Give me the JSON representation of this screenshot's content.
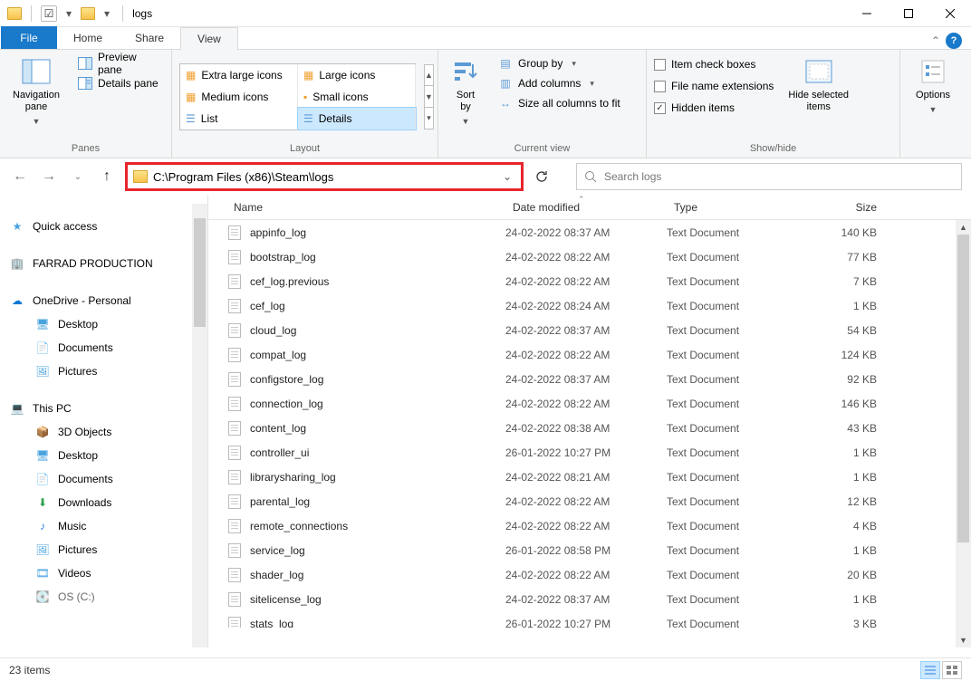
{
  "title": "logs",
  "tabs": {
    "file": "File",
    "home": "Home",
    "share": "Share",
    "view": "View"
  },
  "ribbon": {
    "panes": {
      "nav": "Navigation\npane",
      "preview": "Preview pane",
      "details": "Details pane",
      "label": "Panes"
    },
    "layout": {
      "xl": "Extra large icons",
      "lg": "Large icons",
      "md": "Medium icons",
      "sm": "Small icons",
      "list": "List",
      "det": "Details",
      "label": "Layout"
    },
    "current": {
      "sort": "Sort\nby",
      "group": "Group by",
      "addcols": "Add columns",
      "sizeall": "Size all columns to fit",
      "label": "Current view"
    },
    "showhide": {
      "itemcb": "Item check boxes",
      "ext": "File name extensions",
      "hidden": "Hidden items",
      "hidesel": "Hide selected\nitems",
      "label": "Show/hide"
    },
    "options": "Options"
  },
  "address": "C:\\Program Files (x86)\\Steam\\logs",
  "search_placeholder": "Search logs",
  "columns": {
    "name": "Name",
    "date": "Date modified",
    "type": "Type",
    "size": "Size"
  },
  "nav": {
    "quick": "Quick access",
    "farrad": "FARRAD PRODUCTION",
    "onedrive": "OneDrive - Personal",
    "desktop": "Desktop",
    "documents": "Documents",
    "pictures": "Pictures",
    "thispc": "This PC",
    "threeD": "3D Objects",
    "downloads": "Downloads",
    "music": "Music",
    "videos": "Videos",
    "osc": "OS (C:)"
  },
  "files": [
    {
      "name": "appinfo_log",
      "date": "24-02-2022 08:37 AM",
      "type": "Text Document",
      "size": "140 KB"
    },
    {
      "name": "bootstrap_log",
      "date": "24-02-2022 08:22 AM",
      "type": "Text Document",
      "size": "77 KB"
    },
    {
      "name": "cef_log.previous",
      "date": "24-02-2022 08:22 AM",
      "type": "Text Document",
      "size": "7 KB"
    },
    {
      "name": "cef_log",
      "date": "24-02-2022 08:24 AM",
      "type": "Text Document",
      "size": "1 KB"
    },
    {
      "name": "cloud_log",
      "date": "24-02-2022 08:37 AM",
      "type": "Text Document",
      "size": "54 KB"
    },
    {
      "name": "compat_log",
      "date": "24-02-2022 08:22 AM",
      "type": "Text Document",
      "size": "124 KB"
    },
    {
      "name": "configstore_log",
      "date": "24-02-2022 08:37 AM",
      "type": "Text Document",
      "size": "92 KB"
    },
    {
      "name": "connection_log",
      "date": "24-02-2022 08:22 AM",
      "type": "Text Document",
      "size": "146 KB"
    },
    {
      "name": "content_log",
      "date": "24-02-2022 08:38 AM",
      "type": "Text Document",
      "size": "43 KB"
    },
    {
      "name": "controller_ui",
      "date": "26-01-2022 10:27 PM",
      "type": "Text Document",
      "size": "1 KB"
    },
    {
      "name": "librarysharing_log",
      "date": "24-02-2022 08:21 AM",
      "type": "Text Document",
      "size": "1 KB"
    },
    {
      "name": "parental_log",
      "date": "24-02-2022 08:22 AM",
      "type": "Text Document",
      "size": "12 KB"
    },
    {
      "name": "remote_connections",
      "date": "24-02-2022 08:22 AM",
      "type": "Text Document",
      "size": "4 KB"
    },
    {
      "name": "service_log",
      "date": "26-01-2022 08:58 PM",
      "type": "Text Document",
      "size": "1 KB"
    },
    {
      "name": "shader_log",
      "date": "24-02-2022 08:22 AM",
      "type": "Text Document",
      "size": "20 KB"
    },
    {
      "name": "sitelicense_log",
      "date": "24-02-2022 08:37 AM",
      "type": "Text Document",
      "size": "1 KB"
    },
    {
      "name": "stats_log",
      "date": "26-01-2022 10:27 PM",
      "type": "Text Document",
      "size": "3 KB"
    }
  ],
  "status": "23 items"
}
